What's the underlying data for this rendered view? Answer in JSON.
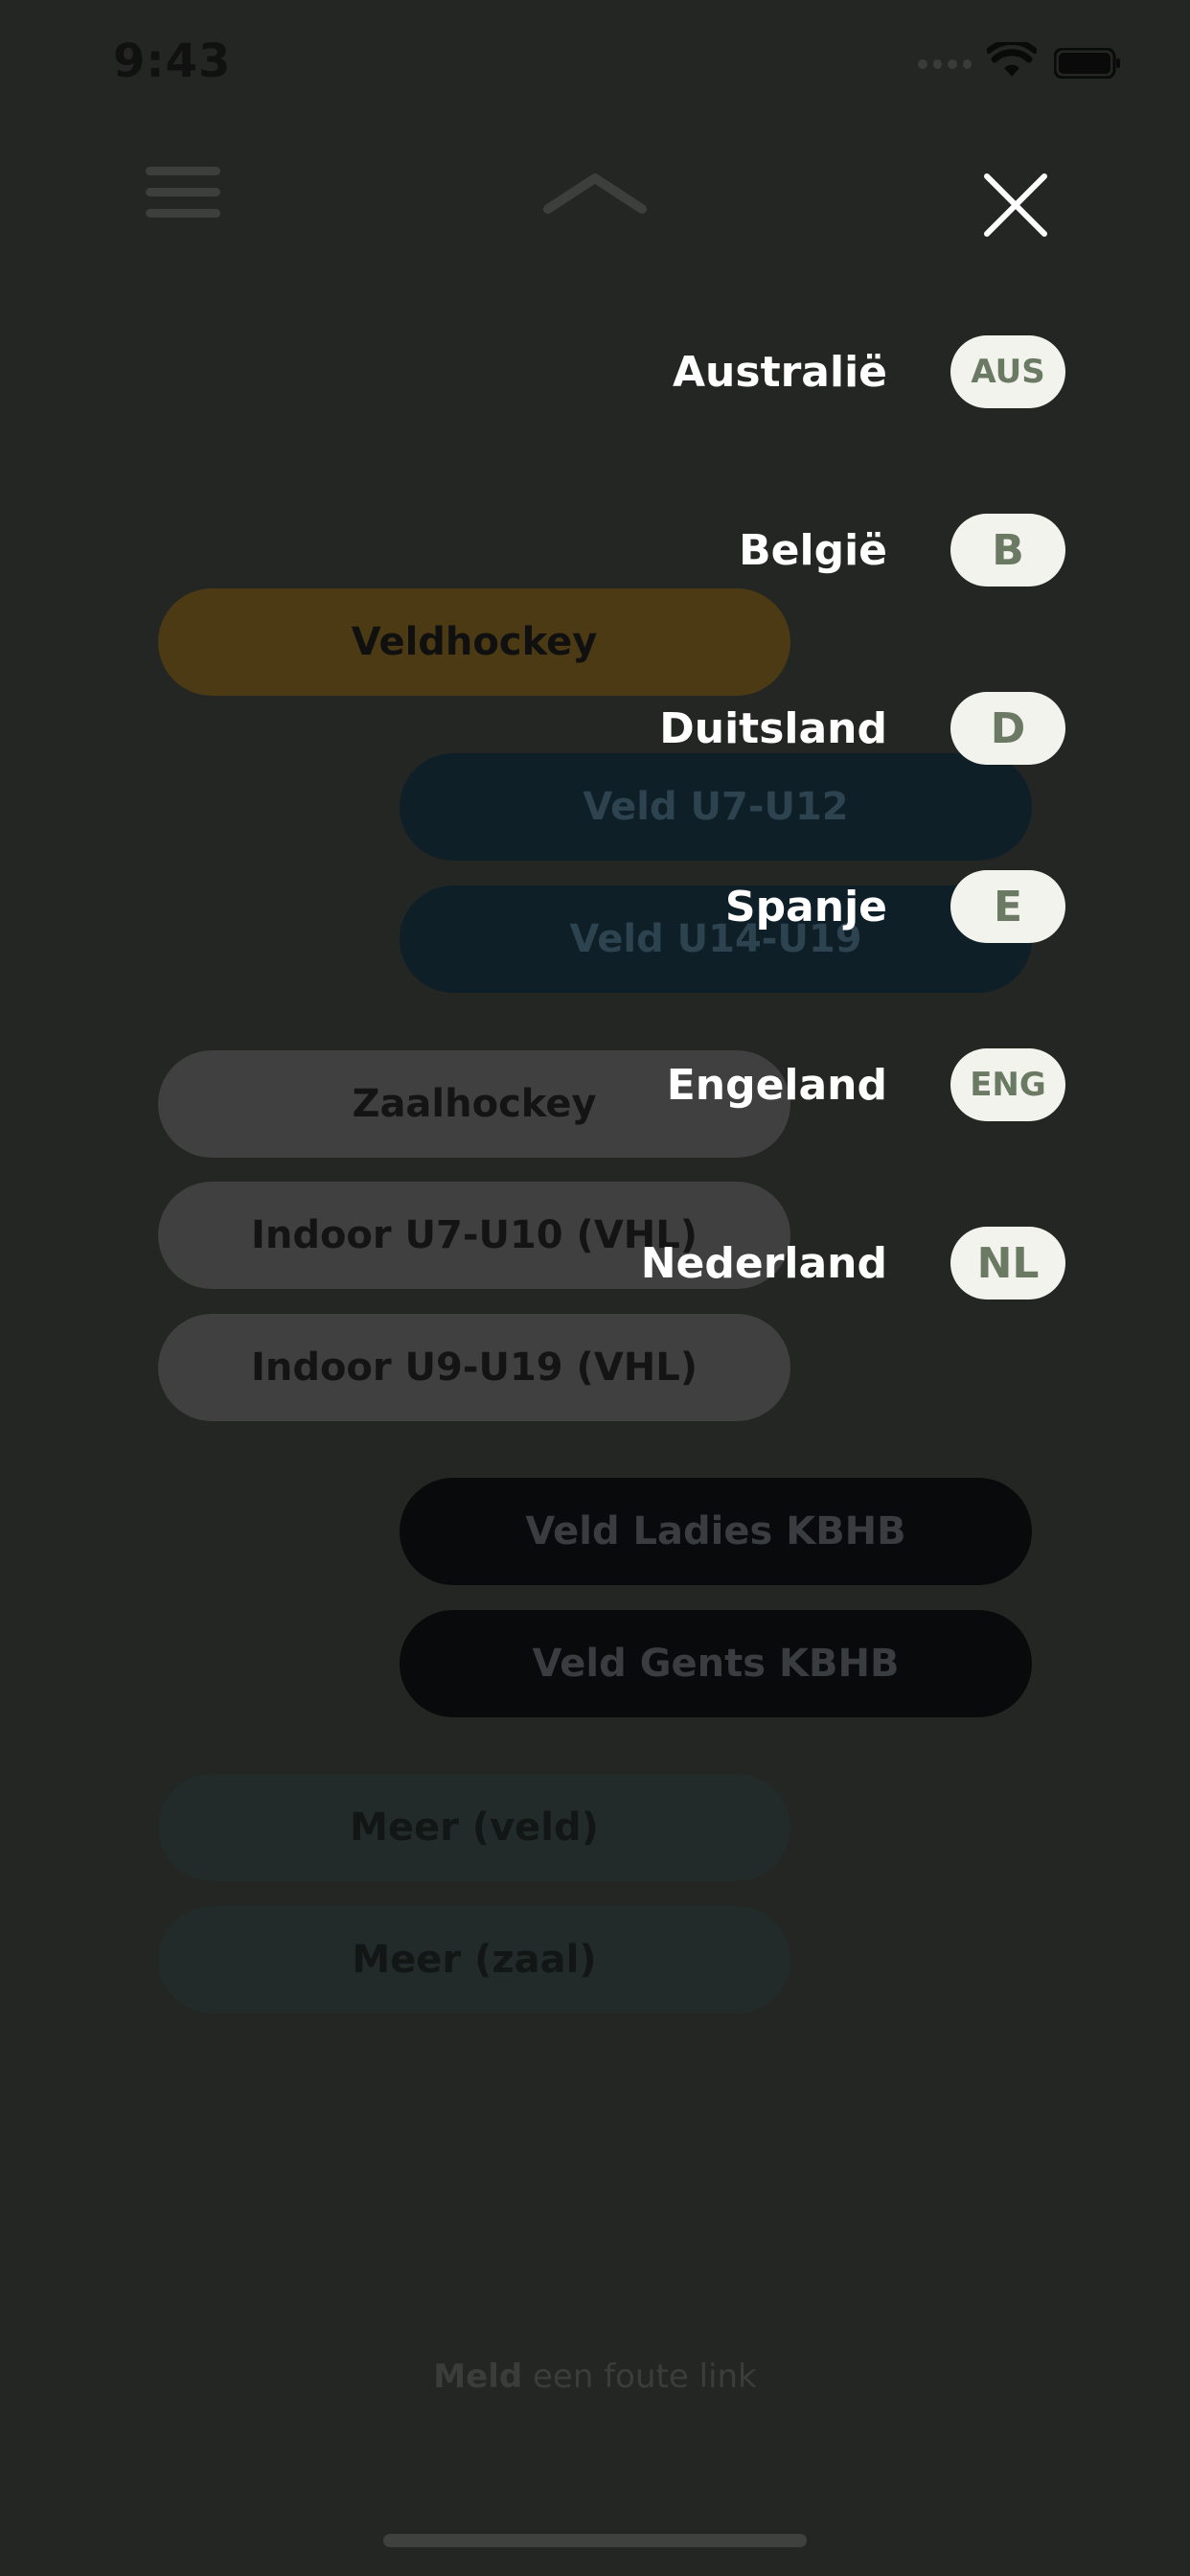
{
  "status_bar": {
    "time": "9:43"
  },
  "pills": {
    "veldhockey": "Veldhockey",
    "veld_u7_u12": "Veld U7-U12",
    "veld_u14_u19": "Veld U14-U19",
    "zaalhockey": "Zaalhockey",
    "indoor_u7_u10": "Indoor U7-U10 (VHL)",
    "indoor_u9_u19": "Indoor U9-U19 (VHL)",
    "veld_ladies": "Veld Ladies KBHB",
    "veld_gents": "Veld Gents KBHB",
    "meer_veld": "Meer (veld)",
    "meer_zaal": "Meer (zaal)"
  },
  "footer": {
    "report_bold": "Meld",
    "report_rest": " een foute link"
  },
  "countries": [
    {
      "name": "Australië",
      "code": "AUS"
    },
    {
      "name": "België",
      "code": "B"
    },
    {
      "name": "Duitsland",
      "code": "D"
    },
    {
      "name": "Spanje",
      "code": "E"
    },
    {
      "name": "Engeland",
      "code": "ENG"
    },
    {
      "name": "Nederland",
      "code": "NL"
    }
  ],
  "icons": {
    "menu": "hamburger-icon",
    "collapse": "chevron-up-icon",
    "close": "close-icon"
  },
  "colors": {
    "overlay_bg": "#242623",
    "badge_bg": "#f3f3ee",
    "badge_text": "#6b7a63",
    "veldhockey_pill": "#4b3a14"
  }
}
